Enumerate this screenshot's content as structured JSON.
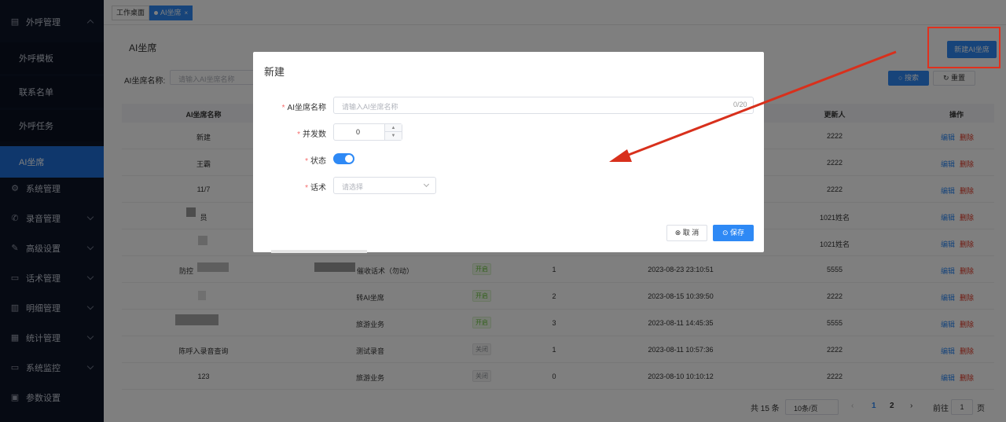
{
  "sidebar": {
    "groups": [
      {
        "label": "外呼管理",
        "icon": "document-icon"
      },
      {
        "label": "系统管理",
        "icon": "gear-icon"
      },
      {
        "label": "录音管理",
        "icon": "phone-icon"
      },
      {
        "label": "高级设置",
        "icon": "edit-icon"
      },
      {
        "label": "话术管理",
        "icon": "chat-icon"
      },
      {
        "label": "明细管理",
        "icon": "list-icon"
      },
      {
        "label": "统计管理",
        "icon": "chart-icon"
      },
      {
        "label": "系统监控",
        "icon": "monitor-icon"
      },
      {
        "label": "参数设置",
        "icon": "settings-icon"
      }
    ],
    "sub_items": [
      "外呼模板",
      "联系名单",
      "外呼任务",
      "AI坐席"
    ]
  },
  "tabs": [
    {
      "label": "工作桌面"
    },
    {
      "label": "AI坐席",
      "close": "×"
    }
  ],
  "page": {
    "title": "AI坐席",
    "new_button": "新建AI坐席",
    "filter_label": "AI坐席名称:",
    "filter_placeholder": "请输入AI坐席名称",
    "search_button": "搜索",
    "reset_button": "重置"
  },
  "table": {
    "columns": [
      "AI坐席名称",
      "更新人",
      "操作"
    ],
    "edit_label": "编辑",
    "delete_label": "删除",
    "rows": [
      {
        "name": "新建",
        "script": "",
        "status": "",
        "concurrency": "",
        "updated_at": "",
        "updater": "2222"
      },
      {
        "name": "王霸",
        "script": "",
        "status": "",
        "concurrency": "",
        "updated_at": "",
        "updater": "2222"
      },
      {
        "name": "11/7",
        "script": "",
        "status": "",
        "concurrency": "",
        "updated_at": "",
        "updater": "2222"
      },
      {
        "name": "员",
        "script": "",
        "status": "",
        "concurrency": "",
        "updated_at": "",
        "updater": "1021姓名"
      },
      {
        "name": "",
        "script": "",
        "status": "",
        "concurrency": "",
        "updated_at": "",
        "updater": "1021姓名"
      },
      {
        "name": "防控",
        "script": "催收话术（勿动）",
        "status": "开启",
        "concurrency": "1",
        "updated_at": "2023-08-23 23:10:51",
        "updater": "5555"
      },
      {
        "name": "",
        "script": "转AI坐席",
        "status": "开启",
        "concurrency": "2",
        "updated_at": "2023-08-15 10:39:50",
        "updater": "2222"
      },
      {
        "name": "",
        "script": "旅游业务",
        "status": "开启",
        "concurrency": "3",
        "updated_at": "2023-08-11 14:45:35",
        "updater": "5555"
      },
      {
        "name": "陈呼入录音查询",
        "script": "测试录音",
        "status": "关闭",
        "concurrency": "1",
        "updated_at": "2023-08-11 10:57:36",
        "updater": "2222"
      },
      {
        "name": "123",
        "script": "旅游业务",
        "status": "关闭",
        "concurrency": "0",
        "updated_at": "2023-08-10 10:10:12",
        "updater": "2222"
      }
    ]
  },
  "pagination": {
    "total": "共 15 条",
    "page_size": "10条/页",
    "prev": "‹",
    "pages": [
      "1",
      "2"
    ],
    "next": "›",
    "goto_label": "前往",
    "goto_value": "1",
    "goto_suffix": "页"
  },
  "dialog": {
    "title": "新建",
    "fields": {
      "name_label": "AI坐席名称",
      "name_placeholder": "请输入AI坐席名称",
      "name_count": "0/20",
      "concurrency_label": "并发数",
      "concurrency_value": "0",
      "status_label": "状态",
      "status_on": true,
      "script_label": "话术",
      "script_placeholder": "请选择"
    },
    "required_mark": "*",
    "cancel_button": "取 消",
    "save_button": "保存"
  },
  "colors": {
    "sidebar_bg": "#0d1426",
    "accent": "#2e89f5",
    "danger": "#e0311e",
    "annotation": "#d8301c"
  }
}
